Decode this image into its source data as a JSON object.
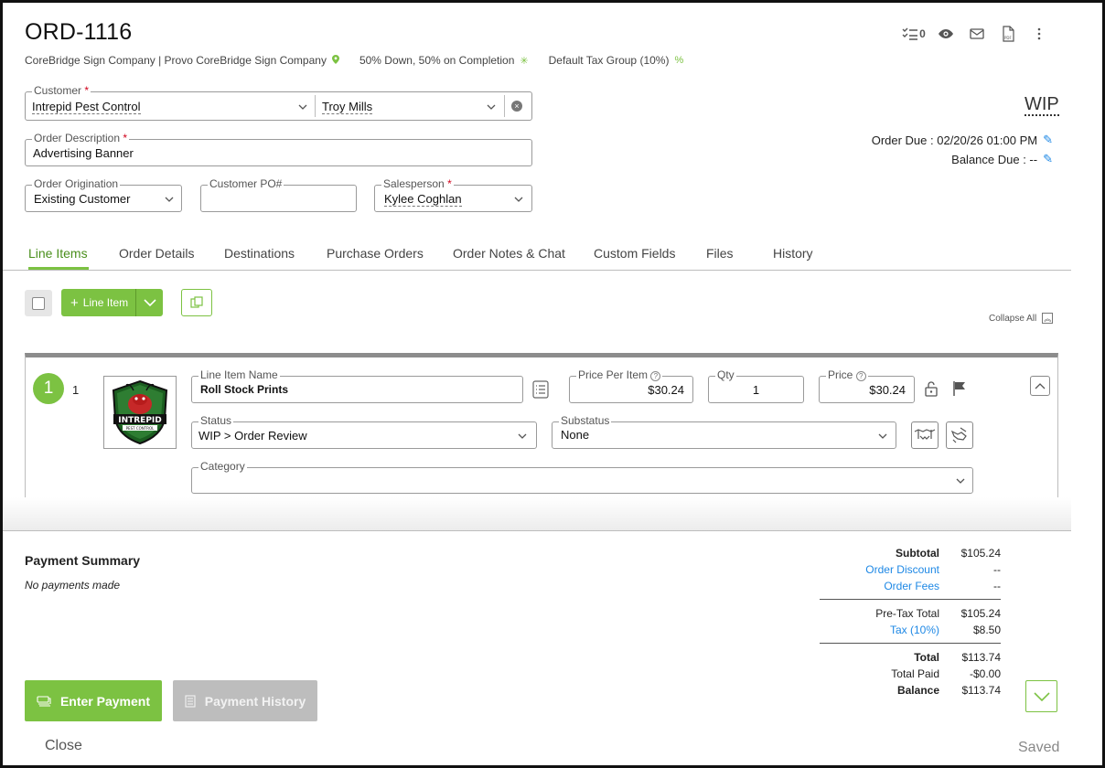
{
  "order": {
    "id": "ORD-1116",
    "company": "CoreBridge Sign Company | Provo CoreBridge Sign Company",
    "payment_terms": "50% Down, 50% on Completion",
    "tax_group": "Default Tax Group (10%)",
    "status": "WIP",
    "order_due_label": "Order Due : 02/20/26 01:00 PM",
    "balance_due_label": "Balance Due : --",
    "task_count": "0"
  },
  "form": {
    "customer_label": "Customer",
    "customer_value": "Intrepid Pest Control",
    "contact_value": "Troy Mills",
    "description_label": "Order Description",
    "description_value": "Advertising Banner",
    "origination_label": "Order Origination",
    "origination_value": "Existing Customer",
    "po_label": "Customer PO#",
    "po_value": "",
    "salesperson_label": "Salesperson",
    "salesperson_value": "Kylee Coghlan",
    "required_mark": "*"
  },
  "tabs": [
    {
      "label": "Line Items",
      "active": true
    },
    {
      "label": "Order Details"
    },
    {
      "label": "Destinations"
    },
    {
      "label": "Purchase Orders"
    },
    {
      "label": "Order Notes & Chat"
    },
    {
      "label": "Custom Fields"
    },
    {
      "label": "Files"
    },
    {
      "label": "History"
    }
  ],
  "line_toolbar": {
    "add_label": "Line Item",
    "collapse_all": "Collapse All"
  },
  "line_item": {
    "badge": "1",
    "index": "1",
    "logo_text": "INTREPID",
    "logo_subtext": "PEST CONTROL",
    "name_label": "Line Item Name",
    "name_value": "Roll Stock Prints",
    "ppi_label": "Price Per Item",
    "ppi_value": "$30.24",
    "qty_label": "Qty",
    "qty_value": "1",
    "price_label": "Price",
    "price_value": "$30.24",
    "status_label": "Status",
    "status_value": "WIP > Order Review",
    "substatus_label": "Substatus",
    "substatus_value": "None",
    "category_label": "Category",
    "category_value": ""
  },
  "payment": {
    "title": "Payment Summary",
    "none_text": "No payments made",
    "enter_label": "Enter Payment",
    "history_label": "Payment History"
  },
  "summary": {
    "subtotal_label": "Subtotal",
    "subtotal": "$105.24",
    "discount_label": "Order Discount",
    "discount": "--",
    "fees_label": "Order Fees",
    "fees": "--",
    "pretax_label": "Pre-Tax Total",
    "pretax": "$105.24",
    "tax_label": "Tax (10%)",
    "tax": "$8.50",
    "total_label": "Total",
    "total": "$113.74",
    "paid_label": "Total Paid",
    "paid": "-$0.00",
    "balance_label": "Balance",
    "balance": "$113.74"
  },
  "footer": {
    "close_label": "Close",
    "saved_label": "Saved"
  },
  "colors": {
    "accent": "#7cc242",
    "link": "#1e88e5",
    "required": "#d0021b"
  }
}
